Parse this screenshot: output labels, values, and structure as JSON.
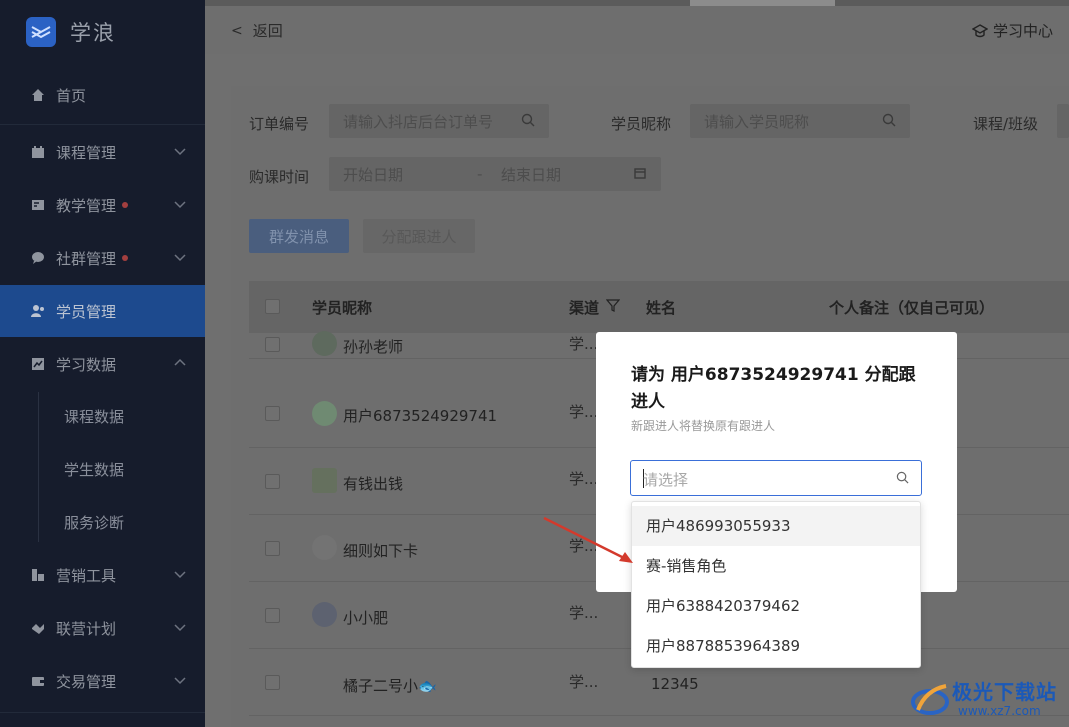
{
  "brand": {
    "name": "学浪"
  },
  "sidebar": {
    "items": [
      {
        "label": "首页",
        "icon": "home-icon"
      },
      {
        "label": "课程管理",
        "icon": "calendar-icon"
      },
      {
        "label": "教学管理",
        "icon": "teach-icon"
      },
      {
        "label": "社群管理",
        "icon": "chat-icon"
      },
      {
        "label": "学员管理",
        "icon": "users-icon"
      },
      {
        "label": "学习数据",
        "icon": "chart-icon"
      },
      {
        "label": "营销工具",
        "icon": "tools-icon"
      },
      {
        "label": "联营计划",
        "icon": "handshake-icon"
      },
      {
        "label": "交易管理",
        "icon": "wallet-icon"
      }
    ],
    "sub_items": [
      "课程数据",
      "学生数据",
      "服务诊断"
    ]
  },
  "topbar": {
    "back_label": "返回",
    "center_label": "学习中心"
  },
  "filters": {
    "order_label": "订单编号",
    "order_placeholder": "请输入抖店后台订单号",
    "nick_label": "学员昵称",
    "nick_placeholder": "请输入学员昵称",
    "course_label": "课程/班级",
    "time_label": "购课时间",
    "start_placeholder": "开始日期",
    "date_sep": "-",
    "end_placeholder": "结束日期"
  },
  "actions": {
    "broadcast": "群发消息",
    "assign": "分配跟进人"
  },
  "table": {
    "headers": {
      "nick": "学员昵称",
      "channel": "渠道",
      "name": "姓名",
      "note": "个人备注（仅自己可见）"
    },
    "rows": [
      {
        "nick": "孙孙老师",
        "channel": "学...",
        "name": ""
      },
      {
        "nick": "用户6873524929741",
        "channel": "学...",
        "name": ""
      },
      {
        "nick": "有钱出钱",
        "channel": "学...",
        "name": ""
      },
      {
        "nick": "细则如下卡",
        "channel": "学...",
        "name": ""
      },
      {
        "nick": "小小肥",
        "channel": "学...",
        "name": ""
      },
      {
        "nick": "橘子二号小🐟",
        "channel": "学...",
        "name": "12345"
      }
    ]
  },
  "modal": {
    "title": "请为 用户6873524929741 分配跟进人",
    "hint": "新跟进人将替换原有跟进人",
    "select_placeholder": "请选择",
    "options": [
      "用户486993055933",
      "赛-销售角色",
      "用户6388420379462",
      "用户8878853964389"
    ]
  },
  "watermark": {
    "title": "极光下载站",
    "url": "www.xz7.com"
  },
  "colors": {
    "accent": "#3a6fd8",
    "sidebar_bg": "#161c2c",
    "active_bg": "#1d4a8e",
    "arrow": "#d33a2c"
  }
}
